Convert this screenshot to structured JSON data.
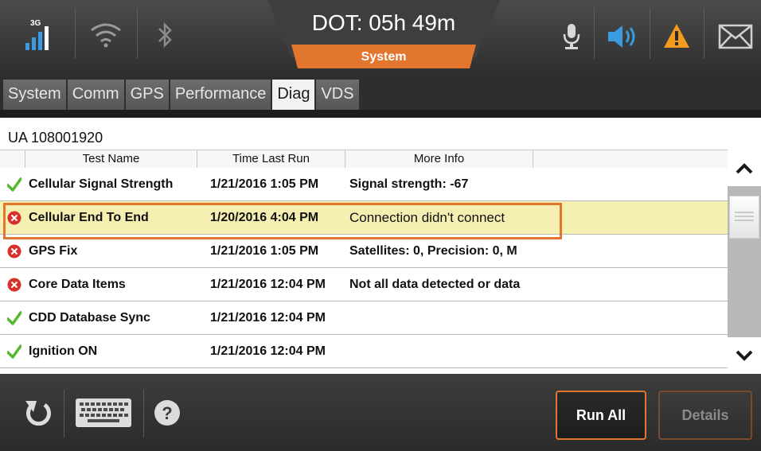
{
  "header": {
    "signal_label": "3G",
    "dot_label": "DOT: 05h 49m",
    "mode_label": "System",
    "icons": [
      "signal-3g-icon",
      "wifi-icon",
      "bluetooth-icon",
      "microphone-icon",
      "speaker-icon",
      "warning-icon",
      "mail-icon"
    ]
  },
  "tabs": [
    {
      "label": "System"
    },
    {
      "label": "Comm"
    },
    {
      "label": "GPS"
    },
    {
      "label": "Performance"
    },
    {
      "label": "Diag"
    },
    {
      "label": "VDS"
    }
  ],
  "active_tab": "Diag",
  "unit_id": "UA 108001920",
  "table": {
    "columns": [
      "Test Name",
      "Time Last Run",
      "More Info"
    ],
    "rows": [
      {
        "status": "pass",
        "name": "Cellular Signal Strength",
        "time": "1/21/2016 1:05 PM",
        "info": "Signal strength: -67"
      },
      {
        "status": "fail",
        "name": "Cellular End To End",
        "time": "1/20/2016 4:04 PM",
        "info": "Connection didn't connect"
      },
      {
        "status": "fail",
        "name": "GPS Fix",
        "time": "1/21/2016 1:05 PM",
        "info": "Satellites: 0, Precision: 0, M"
      },
      {
        "status": "fail",
        "name": "Core Data Items",
        "time": "1/21/2016 12:04 PM",
        "info": "Not all data detected or data"
      },
      {
        "status": "pass",
        "name": "CDD Database Sync",
        "time": "1/21/2016 12:04 PM",
        "info": ""
      },
      {
        "status": "pass",
        "name": "Ignition ON",
        "time": "1/21/2016 12:04 PM",
        "info": ""
      }
    ],
    "selected_row": 1
  },
  "footer": {
    "run_all_label": "Run All",
    "details_label": "Details",
    "icons": [
      "refresh-icon",
      "keyboard-icon",
      "help-icon"
    ]
  },
  "colors": {
    "accent": "#e3762e",
    "pass": "#58b82e",
    "fail": "#d8302b",
    "selected_row": "#f6efb2",
    "speaker": "#3a9be0"
  }
}
